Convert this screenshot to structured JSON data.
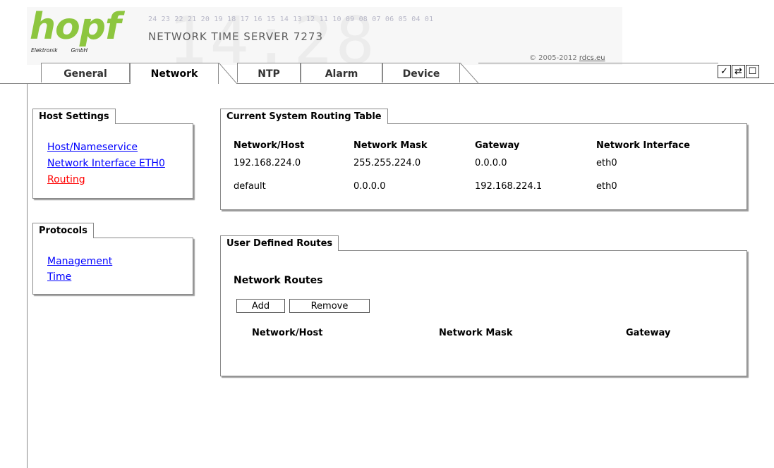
{
  "header": {
    "logo_text": "hopf",
    "logo_sub_left": "Elektronik",
    "logo_sub_right": "GmbH",
    "digit_strip": "24 23 22 21 20 19 18 17 16 15 14 13 12 11 10 09 08 07 06 05 04 01",
    "product_title": "NETWORK TIME SERVER 7273",
    "copyright_prefix": "© 2005-2012",
    "copyright_link": "rdcs.eu",
    "bg_time": "14:28"
  },
  "tabs": [
    {
      "label": "General",
      "active": false
    },
    {
      "label": "Network",
      "active": true
    },
    {
      "label": "NTP",
      "active": false
    },
    {
      "label": "Alarm",
      "active": false
    },
    {
      "label": "Device",
      "active": false
    }
  ],
  "toolbar": {
    "icons": [
      "check-icon",
      "refresh-icon",
      "page-icon"
    ],
    "glyphs": [
      "✓",
      "⇄",
      "☐"
    ]
  },
  "sidebar": {
    "host_settings": {
      "title": "Host Settings",
      "items": [
        {
          "label": "Host/Nameservice",
          "active": false
        },
        {
          "label": "Network Interface ETH0",
          "active": false
        },
        {
          "label": "Routing",
          "active": true
        }
      ]
    },
    "protocols": {
      "title": "Protocols",
      "items": [
        {
          "label": "Management"
        },
        {
          "label": "Time"
        }
      ]
    }
  },
  "routing_table": {
    "title": "Current System Routing Table",
    "columns": [
      "Network/Host",
      "Network Mask",
      "Gateway",
      "Network Interface"
    ],
    "rows": [
      [
        "192.168.224.0",
        "255.255.224.0",
        "0.0.0.0",
        "eth0"
      ],
      [
        "default",
        "0.0.0.0",
        "192.168.224.1",
        "eth0"
      ]
    ]
  },
  "user_routes": {
    "title": "User Defined Routes",
    "section_title": "Network Routes",
    "add_label": "Add",
    "remove_label": "Remove",
    "columns": [
      "Network/Host",
      "Network Mask",
      "Gateway"
    ]
  },
  "colors": {
    "logo_green": "#8dc63f",
    "link_blue": "#0000ff",
    "link_active_red": "#ff0000"
  }
}
